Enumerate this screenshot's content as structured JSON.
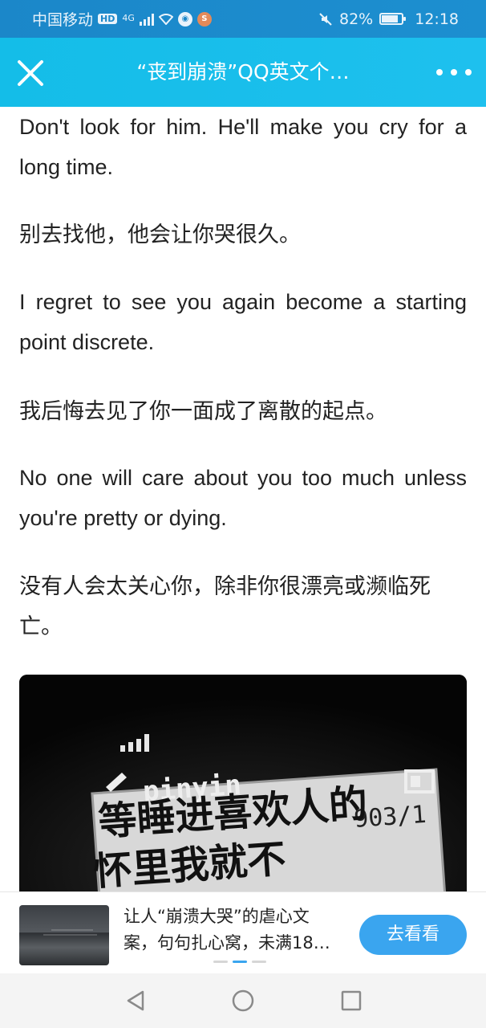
{
  "status_bar": {
    "carrier": "中国移动",
    "hd": "HD",
    "network": "4G",
    "battery": "82%",
    "battery_level": 0.82,
    "time": "12:18",
    "notif_badge": "≋"
  },
  "nav": {
    "title": "“丧到崩溃”QQ英文个…"
  },
  "article": {
    "paragraphs": [
      {
        "lang": "en",
        "text": "Don't look for him. He'll make you cry for a long time."
      },
      {
        "lang": "zh",
        "text": "别去找他，他会让你哭很久。"
      },
      {
        "lang": "en",
        "text": "I regret to see you again become a starting point discrete."
      },
      {
        "lang": "zh",
        "text": "我后悔去见了你一面成了离散的起点。"
      },
      {
        "lang": "en",
        "text": "No one will care about you too much unless you're pretty or dying."
      },
      {
        "lang": "zh",
        "text": "没有人会太关心你，除非你很漂亮或濒临死亡。"
      }
    ],
    "image": {
      "screen_brand": "pinyin",
      "screen_counter": "903/1",
      "screen_line1": "等睡进喜欢人的",
      "screen_line2": "怀里我就不"
    }
  },
  "ad": {
    "line1": "让人“崩溃大哭”的虐心文",
    "line2": "案，句句扎心窝，未满18…",
    "button": "去看看",
    "active_page": 1,
    "page_count": 3
  },
  "colors": {
    "statusbar": "#1b87c9",
    "navbar": "#18bfec",
    "accent": "#3aa5ef"
  }
}
